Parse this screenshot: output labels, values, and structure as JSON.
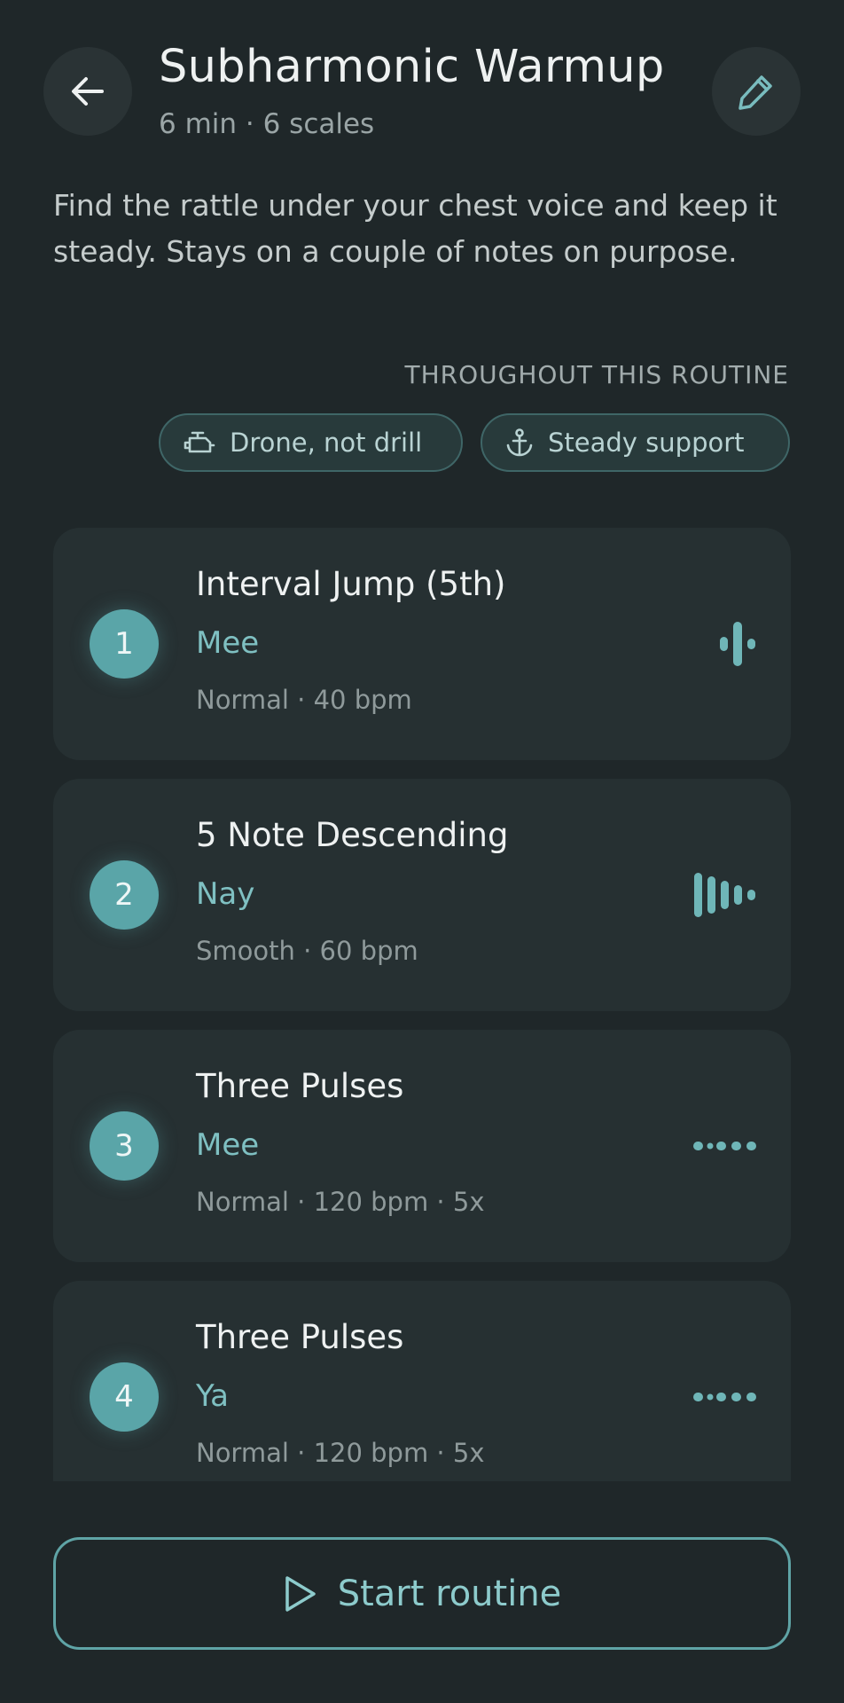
{
  "header": {
    "title": "Subharmonic Warmup",
    "subtitle": "6 min · 6 scales",
    "back_icon": "arrow-left-icon",
    "edit_icon": "pencil-icon"
  },
  "description": "Find the rattle under your chest voice and keep it steady. Stays on a couple of notes on purpose.",
  "throughout": {
    "label": "THROUGHOUT THIS ROUTINE",
    "chips": [
      {
        "label": "Drone, not drill",
        "icon": "engine-icon"
      },
      {
        "label": "Steady support",
        "icon": "anchor-icon"
      }
    ]
  },
  "exercises": [
    {
      "number": "1",
      "name": "Interval Jump (5th)",
      "syllable": "Mee",
      "meta": "Normal · 40 bpm",
      "icon": "interval-wave-icon"
    },
    {
      "number": "2",
      "name": "5 Note Descending",
      "syllable": "Nay",
      "meta": "Smooth · 60 bpm",
      "icon": "descending-bars-icon"
    },
    {
      "number": "3",
      "name": "Three Pulses",
      "syllable": "Mee",
      "meta": "Normal · 120 bpm · 5x",
      "icon": "pulse-dots-icon"
    },
    {
      "number": "4",
      "name": "Three Pulses",
      "syllable": "Ya",
      "meta": "Normal · 120 bpm · 5x",
      "icon": "pulse-dots-icon"
    }
  ],
  "footer": {
    "start_label": "Start routine",
    "start_icon": "play-icon"
  },
  "colors": {
    "background": "#1f2729",
    "card": "#263032",
    "accent": "#5aa5a8",
    "accent_text": "#7fc0c2"
  }
}
